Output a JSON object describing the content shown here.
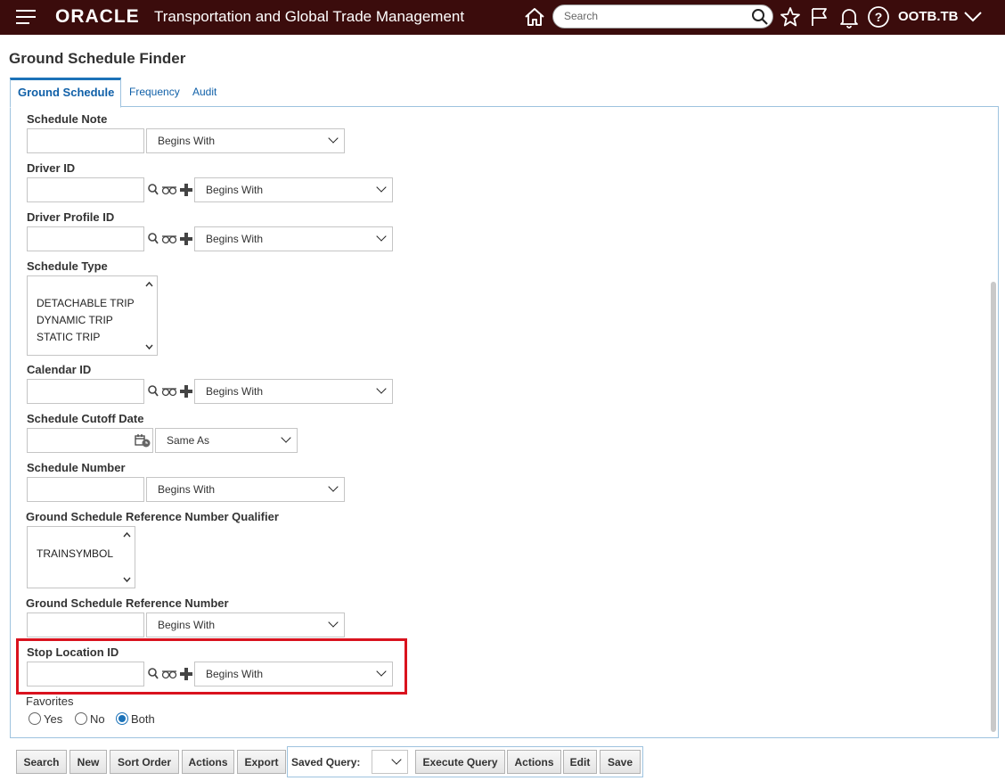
{
  "header": {
    "logo": "ORACLE",
    "app_title": "Transportation and Global Trade Management",
    "search_placeholder": "Search",
    "user": "OOTB.TB"
  },
  "page": {
    "title": "Ground Schedule Finder"
  },
  "tabs": [
    {
      "label": "Ground Schedule",
      "active": true
    },
    {
      "label": "Frequency",
      "active": false
    },
    {
      "label": "Audit",
      "active": false
    }
  ],
  "fields": {
    "schedule_note": {
      "label": "Schedule Note",
      "operator": "Begins With"
    },
    "driver_id": {
      "label": "Driver ID",
      "operator": "Begins With"
    },
    "driver_profile_id": {
      "label": "Driver Profile ID",
      "operator": "Begins With"
    },
    "schedule_type": {
      "label": "Schedule Type",
      "options": [
        "DETACHABLE TRIP",
        "DYNAMIC TRIP",
        "STATIC TRIP"
      ]
    },
    "calendar_id": {
      "label": "Calendar ID",
      "operator": "Begins With"
    },
    "schedule_cutoff_date": {
      "label": "Schedule Cutoff Date",
      "operator": "Same As"
    },
    "schedule_number": {
      "label": "Schedule Number",
      "operator": "Begins With"
    },
    "ref_qualifier": {
      "label": "Ground Schedule Reference Number Qualifier",
      "options": [
        "TRAINSYMBOL"
      ]
    },
    "ref_number": {
      "label": "Ground Schedule Reference Number",
      "operator": "Begins With"
    },
    "stop_location_id": {
      "label": "Stop Location ID",
      "operator": "Begins With"
    },
    "favorites": {
      "label": "Favorites",
      "options": [
        "Yes",
        "No",
        "Both"
      ],
      "selected": "Both"
    }
  },
  "buttons": {
    "search": "Search",
    "new": "New",
    "sort_order": "Sort Order",
    "actions": "Actions",
    "export": "Export",
    "saved_query_label": "Saved Query:",
    "execute_query": "Execute Query",
    "actions2": "Actions",
    "edit": "Edit",
    "save": "Save"
  },
  "colors": {
    "header_bg": "#3b0c0c",
    "link": "#1060a8",
    "highlight": "#d9121e",
    "radio_on": "#1c72b8"
  }
}
